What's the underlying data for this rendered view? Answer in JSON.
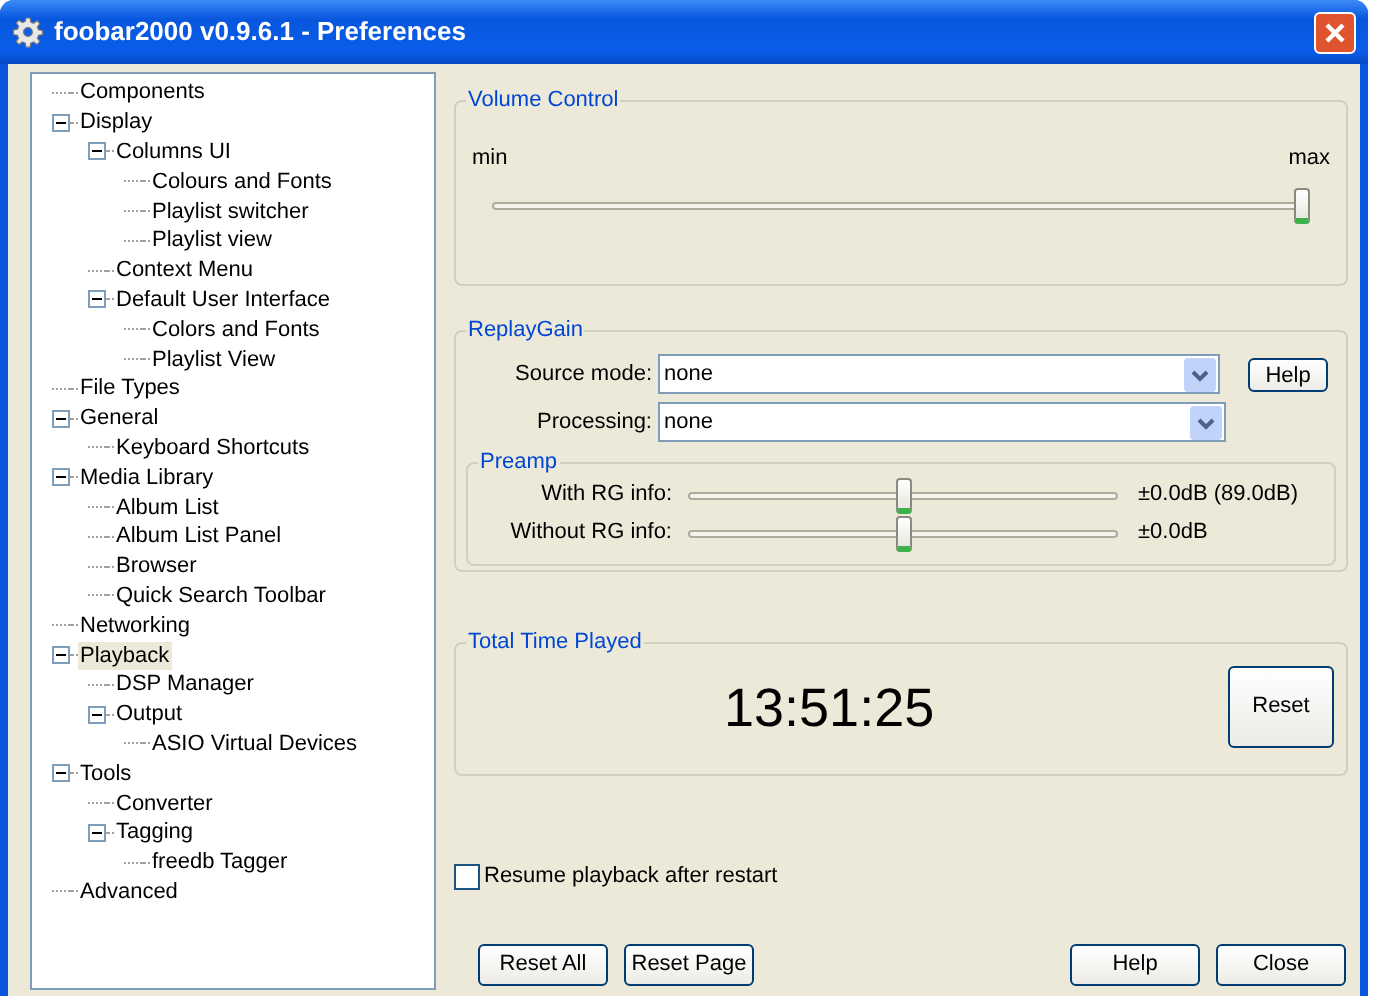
{
  "window": {
    "title": "foobar2000 v0.9.6.1 - Preferences"
  },
  "tree": [
    {
      "label": "Components",
      "selected": false
    },
    {
      "label": "Display",
      "selected": false,
      "expanded": true,
      "children": [
        {
          "label": "Columns UI",
          "selected": false,
          "expanded": true,
          "children": [
            {
              "label": "Colours and Fonts",
              "selected": false
            },
            {
              "label": "Playlist switcher",
              "selected": false
            },
            {
              "label": "Playlist view",
              "selected": false
            }
          ]
        },
        {
          "label": "Context Menu",
          "selected": false
        },
        {
          "label": "Default User Interface",
          "selected": false,
          "expanded": true,
          "children": [
            {
              "label": "Colors and Fonts",
              "selected": false
            },
            {
              "label": "Playlist View",
              "selected": false
            }
          ]
        }
      ]
    },
    {
      "label": "File Types",
      "selected": false
    },
    {
      "label": "General",
      "selected": false,
      "expanded": true,
      "children": [
        {
          "label": "Keyboard Shortcuts",
          "selected": false
        }
      ]
    },
    {
      "label": "Media Library",
      "selected": false,
      "expanded": true,
      "children": [
        {
          "label": "Album List",
          "selected": false
        },
        {
          "label": "Album List Panel",
          "selected": false
        },
        {
          "label": "Browser",
          "selected": false
        },
        {
          "label": "Quick Search Toolbar",
          "selected": false
        }
      ]
    },
    {
      "label": "Networking",
      "selected": false
    },
    {
      "label": "Playback",
      "selected": true,
      "expanded": true,
      "children": [
        {
          "label": "DSP Manager",
          "selected": false
        },
        {
          "label": "Output",
          "selected": false,
          "expanded": true,
          "children": [
            {
              "label": "ASIO Virtual Devices",
              "selected": false
            }
          ]
        }
      ]
    },
    {
      "label": "Tools",
      "selected": false,
      "expanded": true,
      "children": [
        {
          "label": "Converter",
          "selected": false
        },
        {
          "label": "Tagging",
          "selected": false,
          "expanded": true,
          "children": [
            {
              "label": "freedb Tagger",
              "selected": false
            }
          ]
        }
      ]
    },
    {
      "label": "Advanced",
      "selected": false
    }
  ],
  "volume_control": {
    "title": "Volume Control",
    "min_label": "min",
    "max_label": "max",
    "level": 1.0
  },
  "replaygain": {
    "title": "ReplayGain",
    "source_mode": {
      "label": "Source mode:",
      "value": "none"
    },
    "help_button": "Help",
    "processing": {
      "label": "Processing:",
      "value": "none"
    },
    "preamp": {
      "title": "Preamp",
      "rows": [
        {
          "label": "With RG info:",
          "level": 0.5,
          "reading": "±0.0dB (89.0dB)"
        },
        {
          "label": "Without RG info:",
          "level": 0.5,
          "reading": "±0.0dB"
        }
      ]
    }
  },
  "total_time_played": {
    "title": "Total Time Played",
    "time": "13:51:25",
    "reset_button": "Reset"
  },
  "resume_checkbox": {
    "label": "Resume playback after restart",
    "checked": false
  },
  "buttons_left": [
    "Reset All",
    "Reset Page"
  ],
  "buttons_right": [
    "Help",
    "Close"
  ]
}
